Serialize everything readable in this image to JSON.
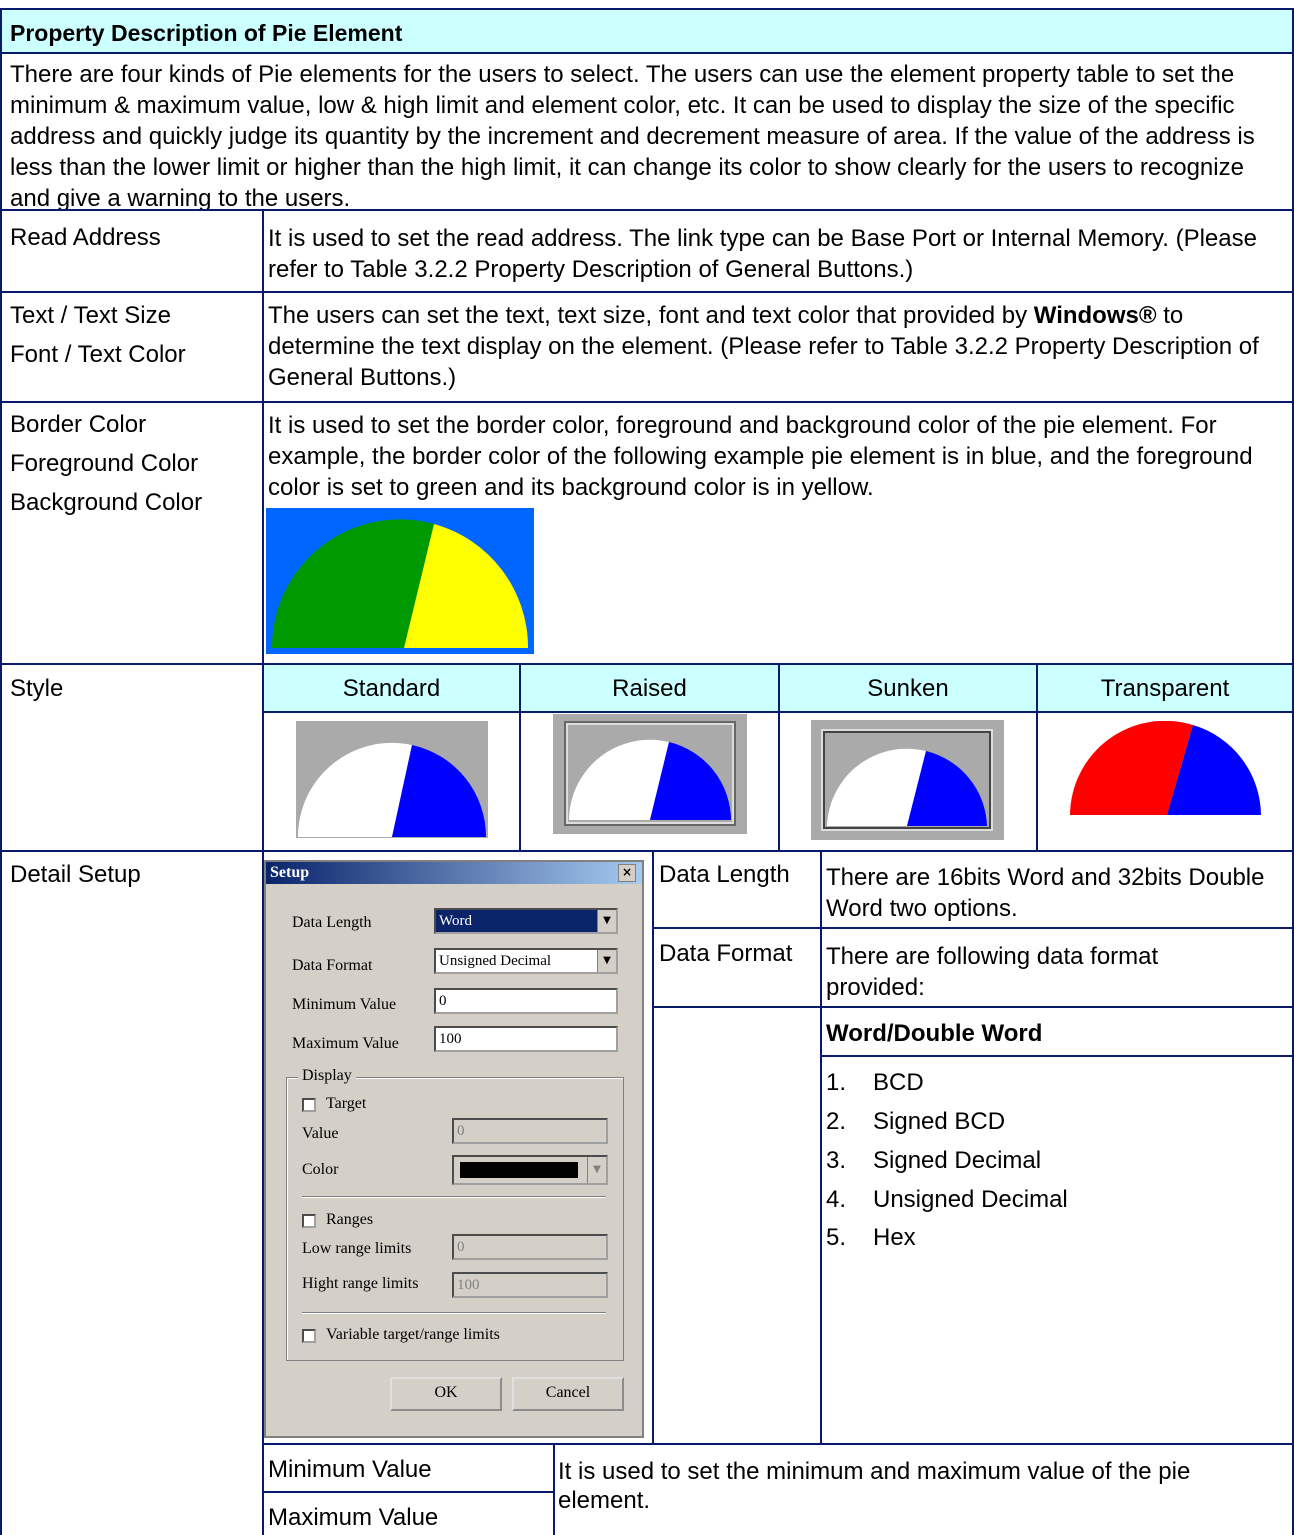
{
  "header": {
    "title": "Property Description of Pie Element"
  },
  "intro": "There are four kinds of Pie elements for the users to select. The users can use the element property table to set the minimum & maximum value, low & high limit and element color, etc. It can be used to display the size of the specific address and quickly judge its quantity by the increment and decrement measure of area. If the value of the address is less than the lower limit or higher than the high limit, it can change its color to show clearly for the users to recognize and give a warning to the users.",
  "rows": {
    "read_address": {
      "label": "Read Address",
      "desc": "It is used to set the read address. The link type can be Base Port or Internal Memory. (Please refer to Table 3.2.2 Property Description of General Buttons.)"
    },
    "text": {
      "label1": "Text / Text Size",
      "label2": "Font / Text Color",
      "desc_a": "The users can set the text, text size, font and text color that provided by ",
      "desc_bold": "Windows®",
      "desc_b": " to determine the text display on the element. (Please refer to Table 3.2.2 Property Description of General Buttons.)"
    },
    "color": {
      "label1": "Border Color",
      "label2": "Foreground Color",
      "label3": "Background Color",
      "desc": "It is used to set the border color, foreground and background color of the pie element. For example, the border color of the following example pie element is in blue, and the foreground color is set to green and its background color is in yellow."
    },
    "style": {
      "label": "Style",
      "options": [
        "Standard",
        "Raised",
        "Sunken",
        "Transparent"
      ]
    },
    "detail": {
      "label": "Detail Setup"
    }
  },
  "dialog": {
    "title": "Setup",
    "close": "×",
    "data_length_label": "Data Length",
    "data_length_value": "Word",
    "data_format_label": "Data Format",
    "data_format_value": "Unsigned Decimal",
    "min_label": "Minimum Value",
    "min_value": "0",
    "max_label": "Maximum Value",
    "max_value": "100",
    "display_group": "Display",
    "target_label": "Target",
    "value_label": "Value",
    "value_value": "0",
    "color_label": "Color",
    "ranges_label": "Ranges",
    "low_label": "Low range limits",
    "low_value": "0",
    "high_label": "Hight range limits",
    "high_value": "100",
    "variable_label": "Variable target/range limits",
    "ok": "OK",
    "cancel": "Cancel"
  },
  "detail_table": {
    "data_length_label": "Data Length",
    "data_length_desc": "There are 16bits Word and 32bits Double Word two options.",
    "data_format_label": "Data Format",
    "data_format_desc": "There are following data format provided:",
    "formats_header": "Word/Double Word",
    "formats": [
      {
        "num": "1.",
        "name": "BCD"
      },
      {
        "num": "2.",
        "name": "Signed BCD"
      },
      {
        "num": "3.",
        "name": "Signed Decimal"
      },
      {
        "num": "4.",
        "name": "Unsigned Decimal"
      },
      {
        "num": "5.",
        "name": "Hex"
      }
    ]
  },
  "minmax": {
    "min_label": "Minimum Value",
    "max_label": "Maximum Value",
    "desc": "It is used to set the minimum and maximum value of the pie element."
  },
  "colors": {
    "border": "#0a1a6a",
    "header_bg": "#ccffff",
    "blue": "#0066ff",
    "green": "#009900",
    "yellow": "#ffff00"
  }
}
